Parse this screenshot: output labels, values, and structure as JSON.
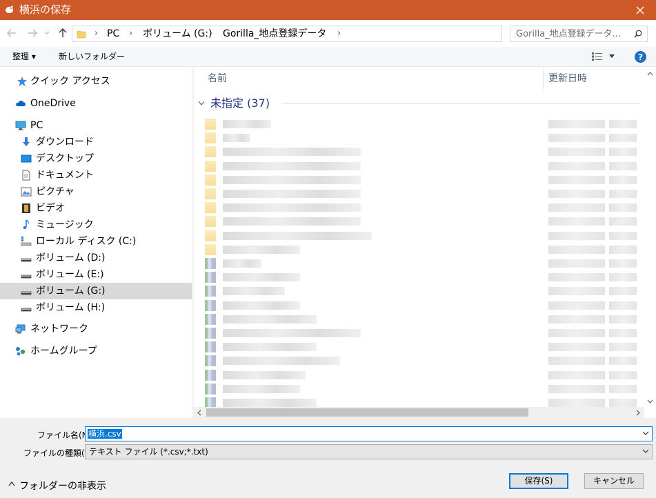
{
  "window": {
    "title": "横浜の保存",
    "accent": "#cd5a28"
  },
  "address": {
    "crumbs": [
      "PC",
      "ボリューム (G:)",
      "Gorilla_地点登録データ"
    ],
    "search_placeholder": "Gorilla_地点登録データ..."
  },
  "toolbar": {
    "organize": "整理 ▾",
    "new_folder": "新しいフォルダー"
  },
  "nav": {
    "quick_access": "クイック アクセス",
    "onedrive": "OneDrive",
    "pc": "PC",
    "downloads": "ダウンロード",
    "desktop": "デスクトップ",
    "documents": "ドキュメント",
    "pictures": "ピクチャ",
    "videos": "ビデオ",
    "music": "ミュージック",
    "local_disk": "ローカル ディスク (C:)",
    "vol_d": "ボリューム (D:)",
    "vol_e": "ボリューム (E:)",
    "vol_g": "ボリューム (G:)",
    "vol_h": "ボリューム (H:)",
    "network": "ネットワーク",
    "homegroup": "ホームグループ"
  },
  "list": {
    "col_name": "名前",
    "col_date": "更新日時",
    "group_label": "未指定 (37)"
  },
  "form": {
    "filename_label": "ファイル名(N):",
    "filename_value": "横浜.csv",
    "filetype_label": "ファイルの種類(T):",
    "filetype_value": "テキスト ファイル (*.csv;*.txt)"
  },
  "footer": {
    "hide_folders": "フォルダーの非表示",
    "save": "保存(S)",
    "cancel": "キャンセル"
  }
}
